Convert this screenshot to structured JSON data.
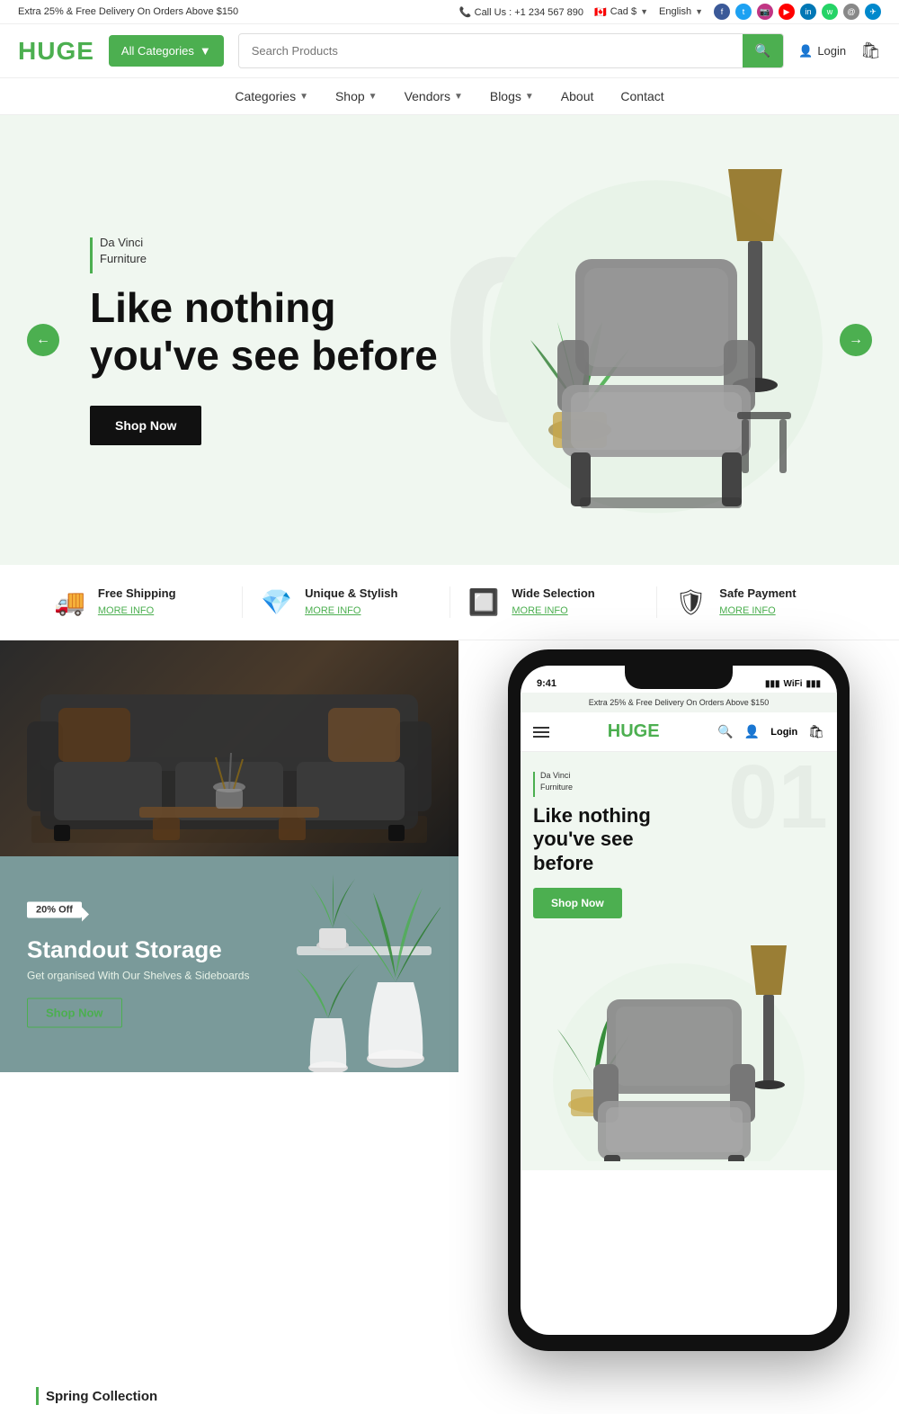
{
  "topbar": {
    "promo_text": "Extra 25% & Free Delivery On Orders Above $150",
    "phone_label": "Call Us : +1 234 567 890",
    "currency": "Cad $",
    "language": "English"
  },
  "header": {
    "logo": "HUGE",
    "categories_btn": "All Categories",
    "search_placeholder": "Search Products",
    "login_label": "Login"
  },
  "nav": {
    "items": [
      {
        "label": "Categories",
        "has_dropdown": true
      },
      {
        "label": "Shop",
        "has_dropdown": true
      },
      {
        "label": "Vendors",
        "has_dropdown": true
      },
      {
        "label": "Blogs",
        "has_dropdown": true
      },
      {
        "label": "About",
        "has_dropdown": false
      },
      {
        "label": "Contact",
        "has_dropdown": false
      }
    ]
  },
  "hero": {
    "slide_number": "01",
    "brand_label_line1": "Da Vinci",
    "brand_label_line2": "Furniture",
    "title_line1": "Like nothing",
    "title_line2": "you've see before",
    "shop_btn": "Shop Now"
  },
  "features": [
    {
      "icon": "truck",
      "title": "Free Shipping",
      "link": "MORE INFO"
    },
    {
      "icon": "diamond",
      "title": "Unique & Stylish",
      "link": "MORE INFO"
    },
    {
      "icon": "grid",
      "title": "Wide Selection",
      "link": "MORE INFO"
    },
    {
      "icon": "shield",
      "title": "Safe Payment",
      "link": "MORE INFO"
    }
  ],
  "storage_banner": {
    "discount": "20% Off",
    "title": "Standout Storage",
    "subtitle": "Get organised With Our Shelves & Sideboards",
    "shop_btn": "Shop Now"
  },
  "phone_mockup": {
    "time": "9:41",
    "top_bar": "Extra 25% & Free Delivery On Orders Above $150",
    "logo": "HUGE",
    "login": "Login",
    "brand_line1": "Da Vinci",
    "brand_line2": "Furniture",
    "title": "Like nothing you've see before",
    "shop_btn": "Shop Now",
    "slide_number": "01"
  },
  "spring_collection": {
    "label": "Spring Collection"
  },
  "social": {
    "icons": [
      "f",
      "t",
      "in",
      "▶",
      "li",
      "w",
      "@",
      "✈"
    ]
  }
}
